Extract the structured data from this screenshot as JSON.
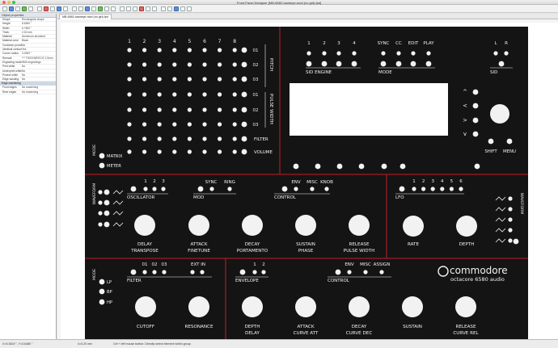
{
  "window": {
    "title": "Front Panel Designer [MB-6582-haxbeye-mod (no girl).fpd]",
    "tab": "MB-6582-haxbeye-mod (no girl).fpd"
  },
  "sidebar": {
    "header": "Object properties",
    "rows": [
      {
        "k": "Shape",
        "v": "Rectangular shape"
      },
      {
        "k": "Height",
        "v": "8.6260 \""
      },
      {
        "k": "Width",
        "v": "6.7500 \""
      },
      {
        "k": "Thick.",
        "v": "2.00 mm"
      },
      {
        "k": "Material",
        "v": "Aluminum anodized"
      },
      {
        "k": "Material color",
        "v": "Black"
      },
      {
        "k": "Customer provide",
        "v": "No"
      },
      {
        "k": "Identical contours",
        "v": "Yes"
      },
      {
        "k": "Corner radius",
        "v": "0.0000 \""
      },
      {
        "k": "Remark",
        "v": "*** THICKNESS IS 1.5mm"
      },
      {
        "k": "Engraving mode",
        "v": "With engravings"
      },
      {
        "k": "Print white",
        "v": "No"
      },
      {
        "k": "Underprint white",
        "v": "No"
      },
      {
        "k": "Protect white",
        "v": "No"
      },
      {
        "k": "Edge sanding",
        "v": "No"
      }
    ],
    "group2": "Edge machining",
    "rows2": [
      {
        "k": "Front edges",
        "v": "No machining"
      },
      {
        "k": "Rear edges",
        "v": "No machining"
      }
    ]
  },
  "status": {
    "coords": "X=5.3619 \", Y=0.6480 \"",
    "zoom": "4=0.20 mm",
    "hint": "Ctrl + left mouse button: Directly select element within group"
  },
  "panel": {
    "sid_matrix": {
      "cols": [
        "1",
        "2",
        "3",
        "4",
        "5",
        "6",
        "7",
        "8"
      ],
      "rows": [
        "01",
        "02",
        "03",
        "01",
        "02",
        "03"
      ],
      "side_top": "PITCH",
      "side_bottom": "PULSE WIDTH",
      "extra_rows": [
        "FILTER",
        "VOLUME"
      ],
      "mode_label": "MODE",
      "modes": [
        "MATRIX",
        "METER"
      ]
    },
    "sid_engine": {
      "nums": [
        "1",
        "2",
        "3",
        "4"
      ],
      "label": "SID ENGINE"
    },
    "mode_block": {
      "nums": [
        "SYNC",
        "CC",
        "EDIT",
        "PLAY"
      ],
      "label": "MODE"
    },
    "sid_lr": {
      "nums": [
        "L",
        "R"
      ],
      "label": "SID"
    },
    "nav": {
      "buttons": [
        "^",
        "<",
        ">",
        "v"
      ],
      "shift": "SHIFT",
      "menu": "MENU"
    },
    "osc": {
      "waveform": "WAVEFORM",
      "nums": [
        "1",
        "2",
        "3"
      ],
      "osc_label": "OSCILLATOR",
      "mod_tabs": [
        "SYNC",
        "RING"
      ],
      "mod_label": "MOD",
      "ctl_tabs": [
        "ENV",
        "MISC",
        "KNOB"
      ],
      "ctl_label": "CONTROL",
      "knobs": [
        {
          "l1": "DELAY",
          "l2": "TRANSPOSE"
        },
        {
          "l1": "ATTACK",
          "l2": "FINETUNE"
        },
        {
          "l1": "DECAY",
          "l2": "PORTAMENTO"
        },
        {
          "l1": "SUSTAIN",
          "l2": "PHASE"
        },
        {
          "l1": "RELEASE",
          "l2": "PULSE WIDTH"
        }
      ]
    },
    "lfo": {
      "nums": [
        "1",
        "2",
        "3",
        "4",
        "5",
        "6"
      ],
      "label": "LFO",
      "waveform": "WAVEFORM",
      "knobs": [
        {
          "l1": "RATE"
        },
        {
          "l1": "DEPTH"
        }
      ]
    },
    "filter": {
      "mode_label": "MODE",
      "modes": [
        "LP",
        "BP",
        "HP"
      ],
      "tabs": [
        "01",
        "02",
        "03"
      ],
      "ext": "EXT IN",
      "label": "FILTER",
      "knobs": [
        {
          "l1": "CUTOFF"
        },
        {
          "l1": "RESONANCE"
        }
      ]
    },
    "env": {
      "nums": [
        "1",
        "2"
      ],
      "label": "ENVELOPE",
      "ctl_tabs": [
        "ENV",
        "MISC",
        "ASSIGN"
      ],
      "ctl_label": "CONTROL",
      "knobs": [
        {
          "l1": "DEPTH",
          "l2": "DELAY"
        },
        {
          "l1": "ATTACK",
          "l2": "CURVE ATT"
        },
        {
          "l1": "DECAY",
          "l2": "CURVE DEC"
        },
        {
          "l1": "SUSTAIN",
          "l2": ""
        },
        {
          "l1": "RELEASE",
          "l2": "CURVE REL"
        }
      ]
    },
    "logo": {
      "brand": "commodore",
      "sub": "octacore 6580 audio"
    },
    "colors": {
      "panel": "#141414",
      "line": "#c41e24",
      "ink": "#f2f2f2"
    }
  }
}
